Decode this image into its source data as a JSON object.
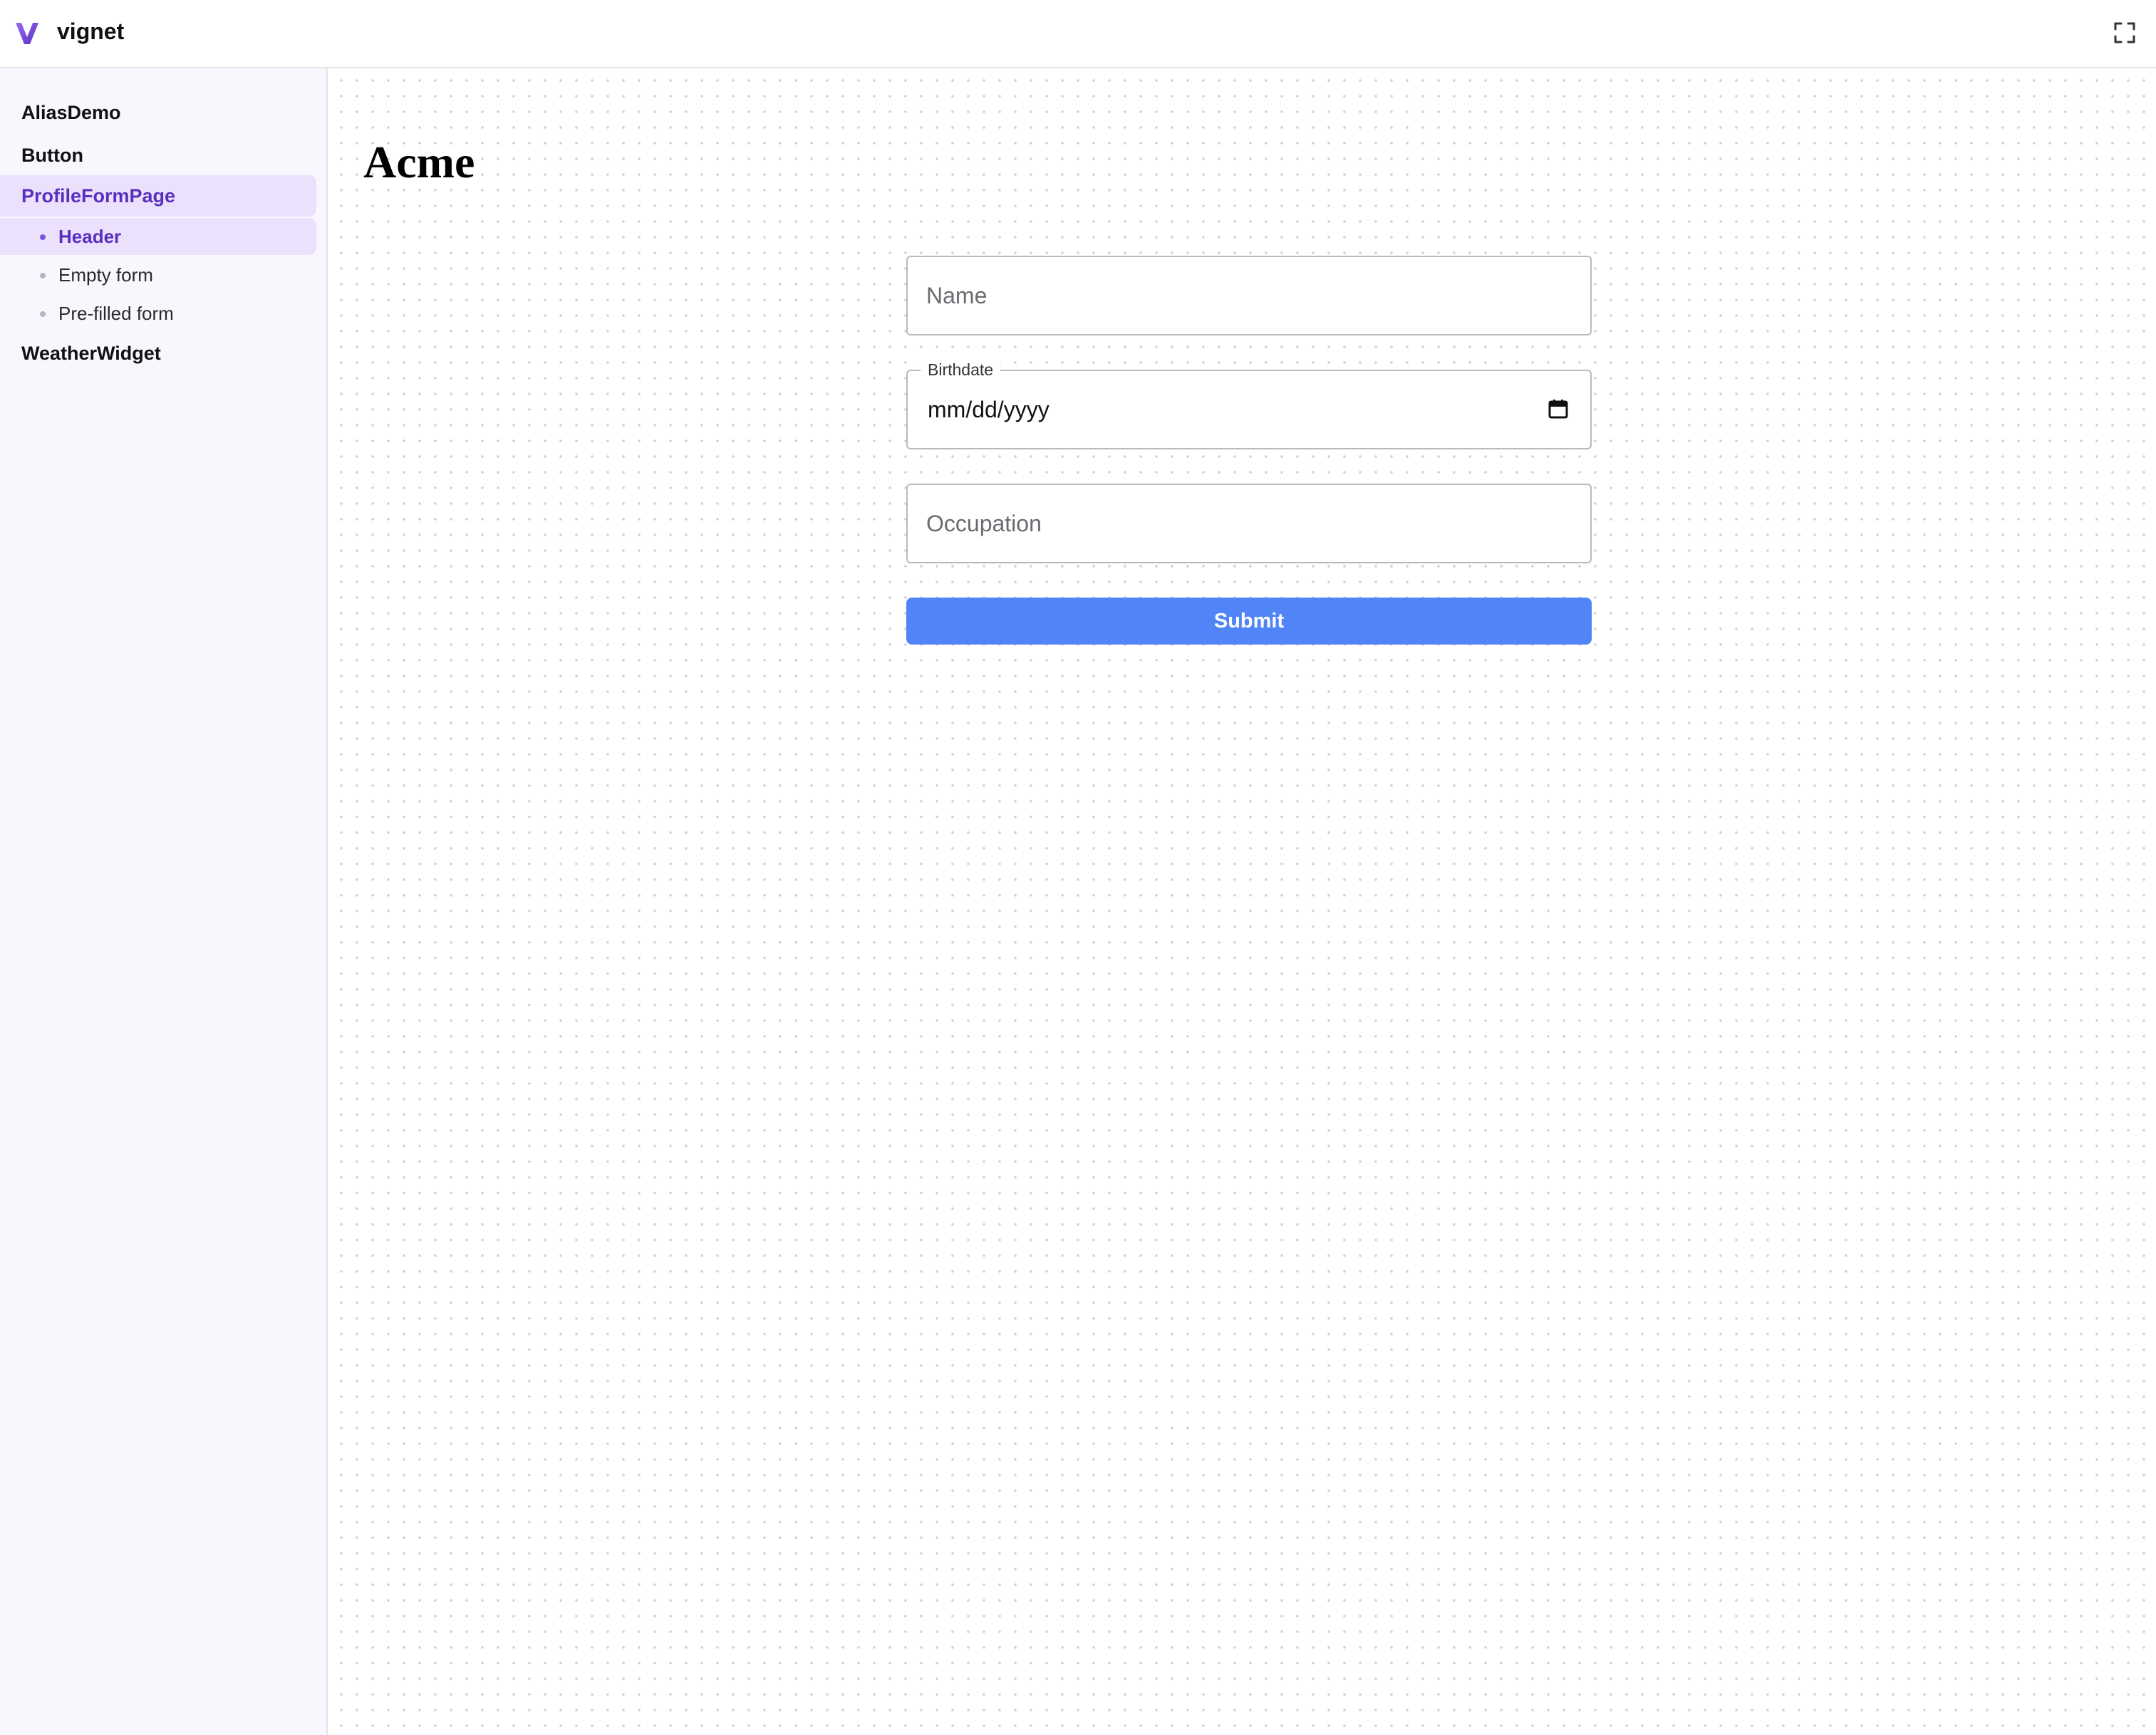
{
  "app": {
    "name": "vignet",
    "fullscreen_icon": "expand-icon",
    "brand_color": "#7b52e0"
  },
  "sidebar": {
    "groups": [
      {
        "label": "AliasDemo",
        "active": false
      },
      {
        "label": "Button",
        "active": false
      },
      {
        "label": "ProfileFormPage",
        "active": true,
        "children": [
          {
            "label": "Header",
            "active": true
          },
          {
            "label": "Empty form",
            "active": false
          },
          {
            "label": "Pre-filled form",
            "active": false
          }
        ]
      },
      {
        "label": "WeatherWidget",
        "active": false
      }
    ],
    "active_bg_color": "#ebe1fd",
    "active_text_color": "#5b2fbe"
  },
  "main": {
    "title": "Acme",
    "form": {
      "name_placeholder": "Name",
      "birthdate_label": "Birthdate",
      "birthdate_value": "mm/dd/yyyy",
      "occupation_placeholder": "Occupation",
      "submit_label": "Submit",
      "submit_color": "#5184f7"
    }
  }
}
